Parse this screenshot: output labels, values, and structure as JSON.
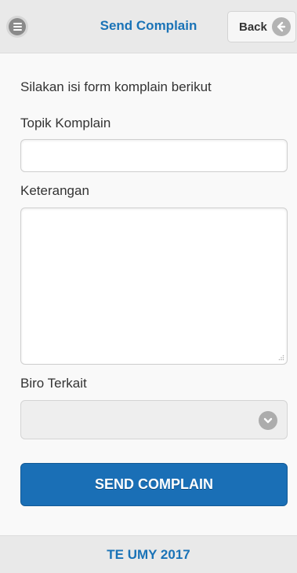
{
  "header": {
    "title": "Send Complain",
    "back_label": "Back",
    "menu_icon": "menu-icon",
    "back_icon": "back-arrow-icon"
  },
  "form": {
    "intro": "Silakan isi form komplain berikut",
    "topik_label": "Topik Komplain",
    "topik_value": "",
    "keterangan_label": "Keterangan",
    "keterangan_value": "",
    "biro_label": "Biro Terkait",
    "biro_value": "",
    "submit_label": "SEND COMPLAIN"
  },
  "footer": {
    "text": "TE UMY 2017"
  },
  "colors": {
    "accent": "#1a73b7",
    "button": "#1a6fb6",
    "header_bg": "#e9e9e9",
    "page_bg": "#f9f9f9"
  }
}
